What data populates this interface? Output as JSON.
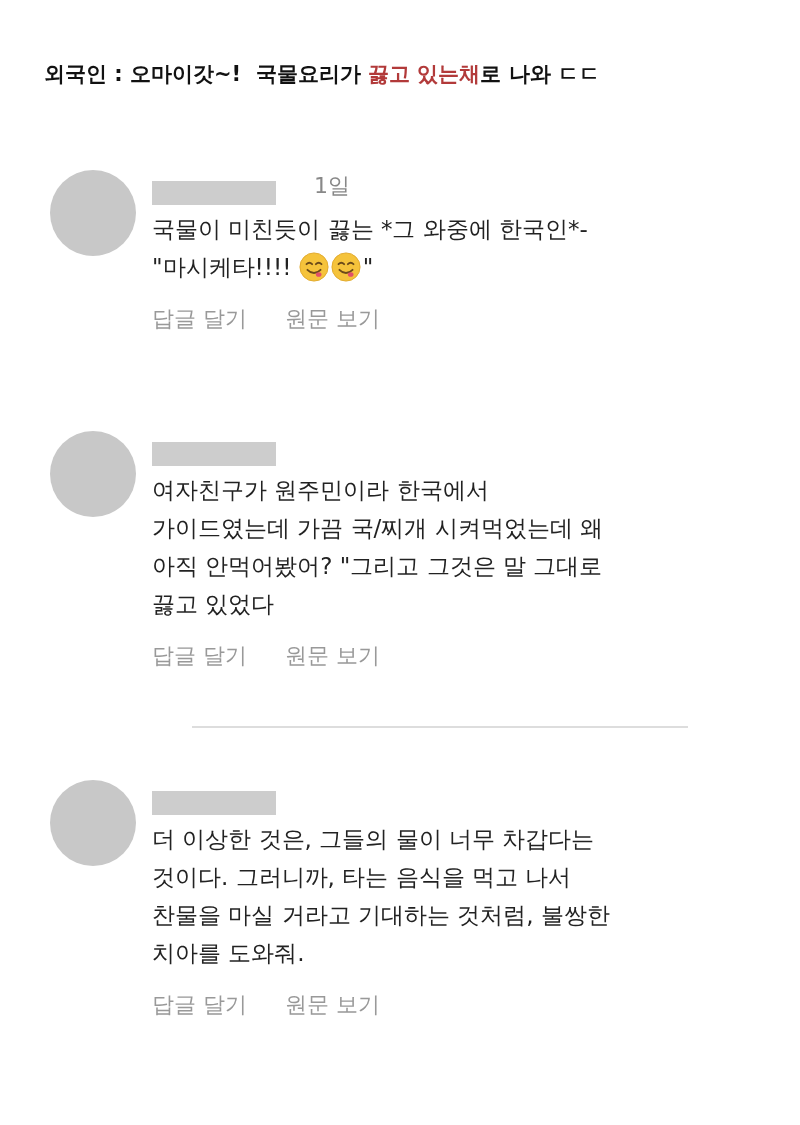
{
  "title": [
    {
      "text": "외국인 : 오마이갓~!  국물요리가 ",
      "highlighted": false
    },
    {
      "text": "끓고 있는채",
      "highlighted": true
    },
    {
      "text": "로 나와 ㄷㄷ",
      "highlighted": false
    }
  ],
  "comments": [
    {
      "time": "1일",
      "lines": [
        [
          {
            "kind": "text",
            "text": "국물이 미친듯이 끓는 *그 와중에 한국인*-"
          }
        ],
        [
          {
            "kind": "text",
            "text": "\"마시케타!!!! "
          },
          {
            "kind": "emoji"
          },
          {
            "kind": "emoji"
          },
          {
            "kind": "text",
            "text": "\""
          }
        ]
      ],
      "actions": [
        "답글 달기",
        "원문 보기"
      ],
      "divider_after": false
    },
    {
      "lines": [
        [
          {
            "kind": "text",
            "text": "여자친구가 원주민이라 한국에서"
          }
        ],
        [
          {
            "kind": "text",
            "text": "가이드였는데 가끔 국/찌개 시켜먹었는데 왜"
          }
        ],
        [
          {
            "kind": "text",
            "text": "아직 안먹어봤어? \"그리고 그것은 말 그대로"
          }
        ],
        [
          {
            "kind": "text",
            "text": "끓고 있었다"
          }
        ]
      ],
      "actions": [
        "답글 달기",
        "원문 보기"
      ],
      "divider_after": true
    },
    {
      "lines": [
        [
          {
            "kind": "text",
            "text": "더 이상한 것은, 그들의 물이 너무 차갑다는"
          }
        ],
        [
          {
            "kind": "text",
            "text": "것이다. 그러니까, 타는 음식을 먹고 나서"
          }
        ],
        [
          {
            "kind": "text",
            "text": "찬물을 마실 거라고 기대하는 것처럼, 불쌍한"
          }
        ],
        [
          {
            "kind": "text",
            "text": "치아를 도와줘."
          }
        ]
      ],
      "actions": [
        "답글 달기",
        "원문 보기"
      ],
      "divider_after": false
    }
  ]
}
